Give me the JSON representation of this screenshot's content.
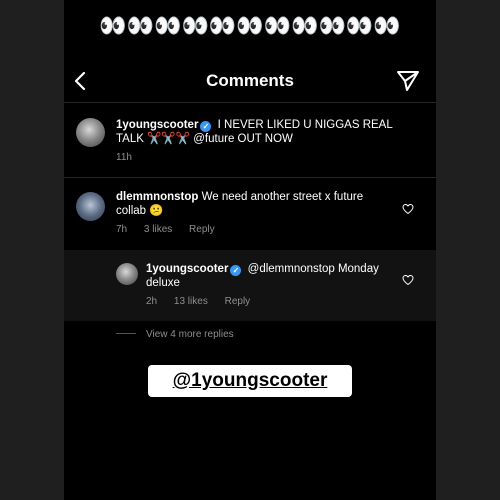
{
  "top_emojis": "👀👀👀👀👀👀👀👀👀👀👀",
  "header": {
    "title": "Comments"
  },
  "comments": [
    {
      "username": "1youngscooter",
      "text": "I NEVER LIKED U NIGGAS REAL TALK ✂️✂️✂️ @future OUT NOW",
      "time": "11h"
    },
    {
      "username": "dlemmnonstop",
      "text": "We need another street x future collab 😕",
      "time": "7h",
      "likes": "3 likes",
      "reply_label": "Reply"
    },
    {
      "username": "1youngscooter",
      "text": "@dlemmnonstop Monday deluxe",
      "time": "2h",
      "likes": "13 likes",
      "reply_label": "Reply"
    }
  ],
  "view_more": "View 4 more replies",
  "sticker": {
    "handle": "@1youngscooter"
  }
}
